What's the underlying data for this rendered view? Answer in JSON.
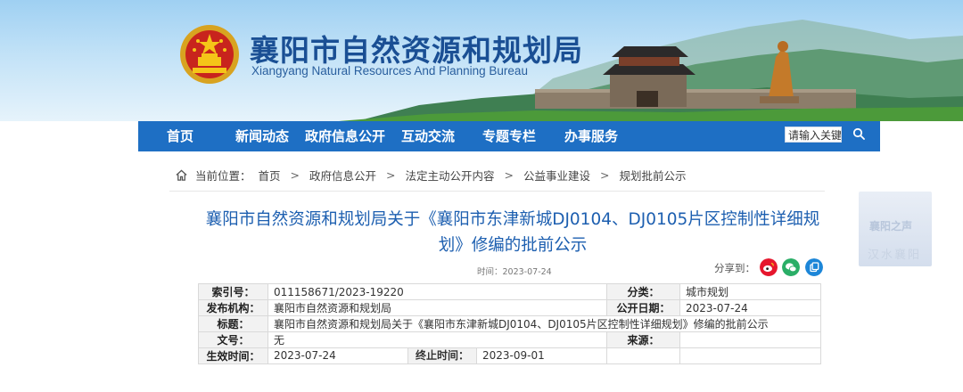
{
  "header": {
    "title_cn": "襄阳市自然资源和规划局",
    "title_en": "Xiangyang Natural Resources And Planning Bureau"
  },
  "nav": {
    "items": [
      "首页",
      "新闻动态",
      "政府信息公开",
      "互动交流",
      "专题专栏",
      "办事服务"
    ],
    "search_placeholder": "请输入关键",
    "active_color": "#1e6fc4"
  },
  "breadcrumb": {
    "prefix": "当前位置：",
    "items": [
      "首页",
      "政府信息公开",
      "法定主动公开内容",
      "公益事业建设",
      "规划批前公示"
    ],
    "separator": ">"
  },
  "article": {
    "title_line1": "襄阳市自然资源和规划局关于《襄阳市东津新城DJ0104、DJ0105片区控制性详细规",
    "title_line2": "划》修编的批前公示",
    "time_label": "时间：2023-07-24",
    "share_label": "分享到：",
    "share_icons": [
      "weibo-icon",
      "wechat-icon",
      "copy-link-icon"
    ]
  },
  "meta": {
    "rows": [
      [
        "索引号：",
        "011158671/2023-19220",
        "分类：",
        "城市规划"
      ],
      [
        "发布机构：",
        "襄阳市自然资源和规划局",
        "公开日期：",
        "2023-07-24"
      ],
      [
        "标题：",
        "襄阳市自然资源和规划局关于《襄阳市东津新城DJ0104、DJ0105片区控制性详细规划》修编的批前公示"
      ],
      [
        "文号：",
        "无",
        "来源：",
        ""
      ],
      [
        "生效时间：",
        "2023-07-24",
        "终止时间：",
        "2023-09-01"
      ]
    ]
  },
  "side_widget": {
    "logo_text": "襄阳之声",
    "sub_text": "汉水襄阳"
  }
}
